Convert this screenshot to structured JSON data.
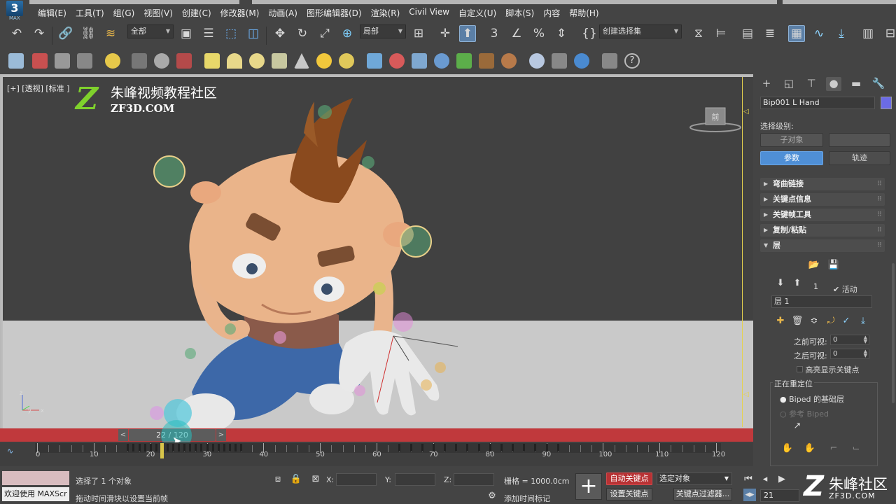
{
  "app": {
    "logo_text": "3",
    "logo_sub": "MAX"
  },
  "menu": {
    "items": [
      "编辑(E)",
      "工具(T)",
      "组(G)",
      "视图(V)",
      "创建(C)",
      "修改器(M)",
      "动画(A)",
      "图形编辑器(D)",
      "渲染(R)",
      "Civil View",
      "自定义(U)",
      "脚本(S)",
      "内容",
      "帮助(H)"
    ]
  },
  "toolbar1": {
    "selection_filter": "全部",
    "reference_coord": "局部",
    "named_selection_set": "创建选择集"
  },
  "viewport": {
    "label": "[+] [透视] [标准] [默认明暗处理]",
    "label_visible": "[+] [透视] [标准 ]",
    "viewcube_face": "前"
  },
  "watermark": {
    "logo_letter": "Z",
    "name_cn": "朱峰视频教程社区",
    "name_en": "ZF3D.COM"
  },
  "command_panel": {
    "object_name": "Bip001 L Hand",
    "object_color": "#6b6be6",
    "selection_level_label": "选择级别:",
    "sub_object_button": "子对象",
    "params_button": "参数",
    "trajectory_button": "轨迹",
    "rollouts": [
      "弯曲链接",
      "关键点信息",
      "关键帧工具",
      "复制/粘贴",
      "层"
    ],
    "layer_index": "1",
    "active_label": "活动",
    "layer_name": "层 1",
    "before_visible_label": "之前可视:",
    "before_visible_value": "0",
    "after_visible_label": "之后可视:",
    "after_visible_value": "0",
    "highlight_keys_label": "高亮显示关键点",
    "retarget_group_label": "正在重定位",
    "biped_base_layer_label": "Biped 的基础层",
    "reference_biped_label": "参考 Biped"
  },
  "timeline": {
    "slider_label": "22 / 120",
    "prev_label": "<",
    "next_label": ">",
    "current_frame": 22,
    "start": 0,
    "end": 120,
    "tick_labels": [
      "0",
      "10",
      "20",
      "30",
      "40",
      "50",
      "60",
      "70",
      "80",
      "90",
      "100",
      "110",
      "120"
    ]
  },
  "status": {
    "maxscript_label": "欢迎使用 MAXScr",
    "selection_status": "选择了 1 个对象",
    "prompt": "拖动时间滑块以设置当前帧",
    "x_label": "X:",
    "y_label": "Y:",
    "z_label": "Z:",
    "grid_label": "栅格 = 1000.0cm",
    "add_time_tag": "添加时间标记",
    "auto_key_button": "自动关键点",
    "set_key_button": "设置关键点",
    "selected_dropdown": "选定对象",
    "key_filters_button": "关键点过滤器...",
    "frame_value": "21"
  },
  "corner_watermark": {
    "logo_letter": "Z",
    "name_cn": "朱峰社区",
    "name_en": "ZF3D.COM"
  },
  "colors": {
    "accent_blue": "#4f8fd6",
    "timebar_red": "#c0393c",
    "auto_key_red": "#b83234",
    "watermark_green": "#7fd12c"
  }
}
